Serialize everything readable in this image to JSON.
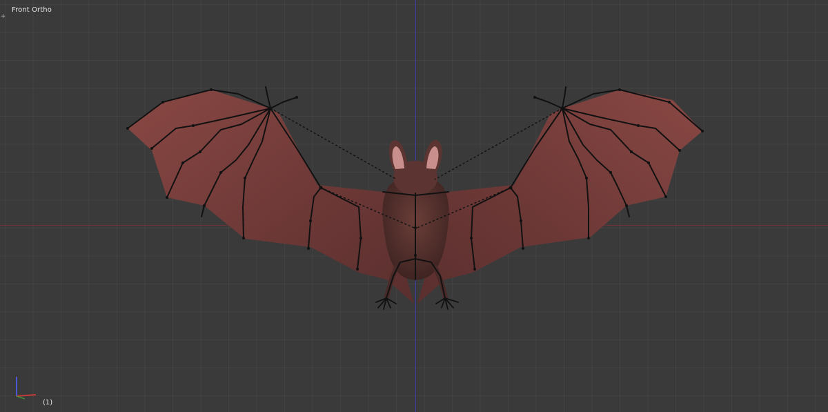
{
  "viewport": {
    "view_label": "Front Ortho",
    "frame_indicator": "(1)",
    "background_color": "#3a3a3a",
    "x_axis_color": "#6e3434",
    "z_axis_color": "#3c3ca8"
  },
  "scene": {
    "object": "bat",
    "wing_membrane_color": "#7a3f3d",
    "armature_color": "#111111"
  },
  "icons": {
    "corner_widget": "plus-icon",
    "axis_gizmo": "axis-gizmo-icon"
  }
}
